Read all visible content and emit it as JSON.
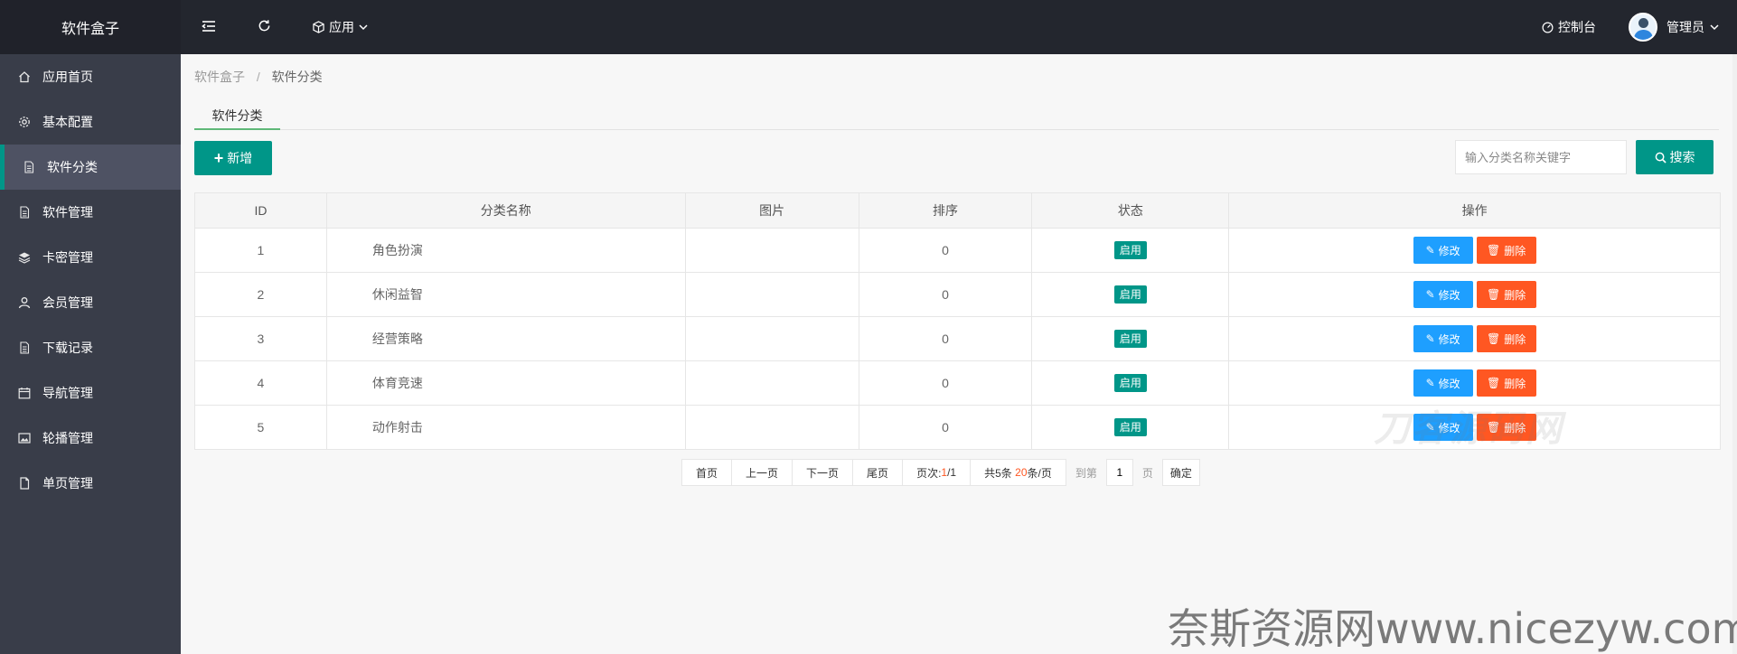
{
  "app": {
    "title": "软件盒子"
  },
  "topbar": {
    "menu_icon": "menu-fold-icon",
    "refresh_icon": "refresh-icon",
    "app_menu_label": "应用",
    "console_label": "控制台",
    "user_name": "管理员"
  },
  "sidebar": {
    "items": [
      {
        "label": "应用首页",
        "icon": "home-icon"
      },
      {
        "label": "基本配置",
        "icon": "gear-icon"
      },
      {
        "label": "软件分类",
        "icon": "file-icon",
        "active": true
      },
      {
        "label": "软件管理",
        "icon": "file-icon"
      },
      {
        "label": "卡密管理",
        "icon": "layers-icon"
      },
      {
        "label": "会员管理",
        "icon": "user-icon"
      },
      {
        "label": "下载记录",
        "icon": "file-icon"
      },
      {
        "label": "导航管理",
        "icon": "calendar-icon"
      },
      {
        "label": "轮播管理",
        "icon": "image-icon"
      },
      {
        "label": "单页管理",
        "icon": "page-icon"
      }
    ]
  },
  "breadcrumb": {
    "root": "软件盒子",
    "sep": "/",
    "current": "软件分类"
  },
  "tab": {
    "label": "软件分类"
  },
  "toolbar": {
    "add_label": "新增",
    "search_placeholder": "输入分类名称关键字",
    "search_label": "搜索"
  },
  "table": {
    "headers": {
      "id": "ID",
      "name": "分类名称",
      "image": "图片",
      "sort": "排序",
      "status": "状态",
      "ops": "操作"
    },
    "rows": [
      {
        "id": "1",
        "name": "角色扮演",
        "sort": "0",
        "status": "启用"
      },
      {
        "id": "2",
        "name": "休闲益智",
        "sort": "0",
        "status": "启用"
      },
      {
        "id": "3",
        "name": "经营策略",
        "sort": "0",
        "status": "启用"
      },
      {
        "id": "4",
        "name": "体育竞速",
        "sort": "0",
        "status": "启用"
      },
      {
        "id": "5",
        "name": "动作射击",
        "sort": "0",
        "status": "启用"
      }
    ],
    "edit_label": "修改",
    "delete_label": "删除"
  },
  "pager": {
    "first": "首页",
    "prev": "上一页",
    "next": "下一页",
    "last": "尾页",
    "page_prefix": "页次:",
    "page_current": "1",
    "page_total": "/1",
    "total_prefix": "共5条",
    "per_page": "20",
    "per_page_suffix": "条/页",
    "goto_prefix": "到第",
    "goto_value": "1",
    "goto_suffix": "页",
    "confirm": "确定"
  },
  "watermarks": {
    "small": "刀客源码网",
    "big": "奈斯资源网www.nicezyw.com"
  },
  "colors": {
    "topbar": "#23262e",
    "sidebar": "#393d49",
    "primary": "#009688",
    "edit": "#1e9fff",
    "delete": "#ff5722"
  }
}
